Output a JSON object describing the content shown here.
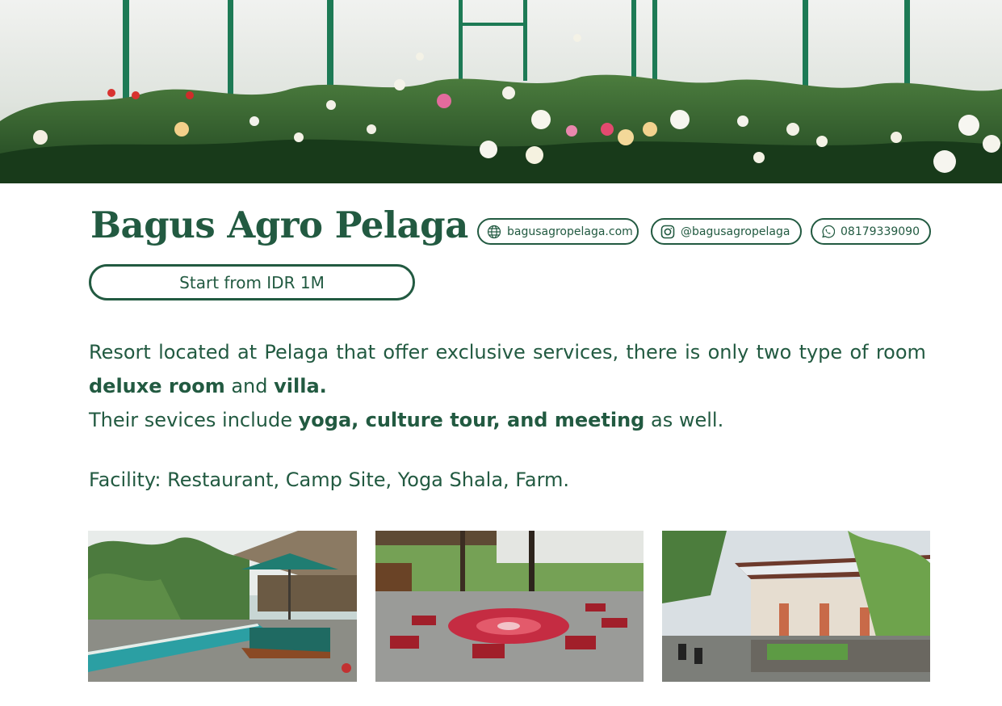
{
  "resort": {
    "name": "Bagus Agro Pelaga",
    "price_label": "Start from IDR 1M"
  },
  "contacts": {
    "website": {
      "icon": "globe-icon",
      "label": "bagusagropelaga.com"
    },
    "instagram": {
      "icon": "instagram-icon",
      "label": "@bagusagropelaga"
    },
    "whatsapp": {
      "icon": "whatsapp-icon",
      "label": "08179339090"
    }
  },
  "description": {
    "line1_words": [
      "Resort",
      "located",
      "at",
      "Pelaga",
      "that",
      "offer",
      "exclusive",
      "services,",
      "there",
      "is",
      "only",
      "two",
      "type",
      "of",
      "room"
    ],
    "room_type_1": "deluxe room",
    "and_text": "and",
    "room_type_2": "villa.",
    "services_prefix": "Their sevices include",
    "services_bold": "yoga, culture tour, and meeting",
    "services_suffix": "as well."
  },
  "facility": "Facility: Restaurant, Camp Site, Yoga Shala, Farm.",
  "colors": {
    "brand_green": "#225a41",
    "background": "#ffffff"
  },
  "images": {
    "hero": "rose-garden-greenhouse",
    "photo_1": "infinity-pool-with-gazebo",
    "photo_2": "yoga-shala-with-flower-mandala",
    "photo_3": "restaurant-building-with-pergola"
  }
}
